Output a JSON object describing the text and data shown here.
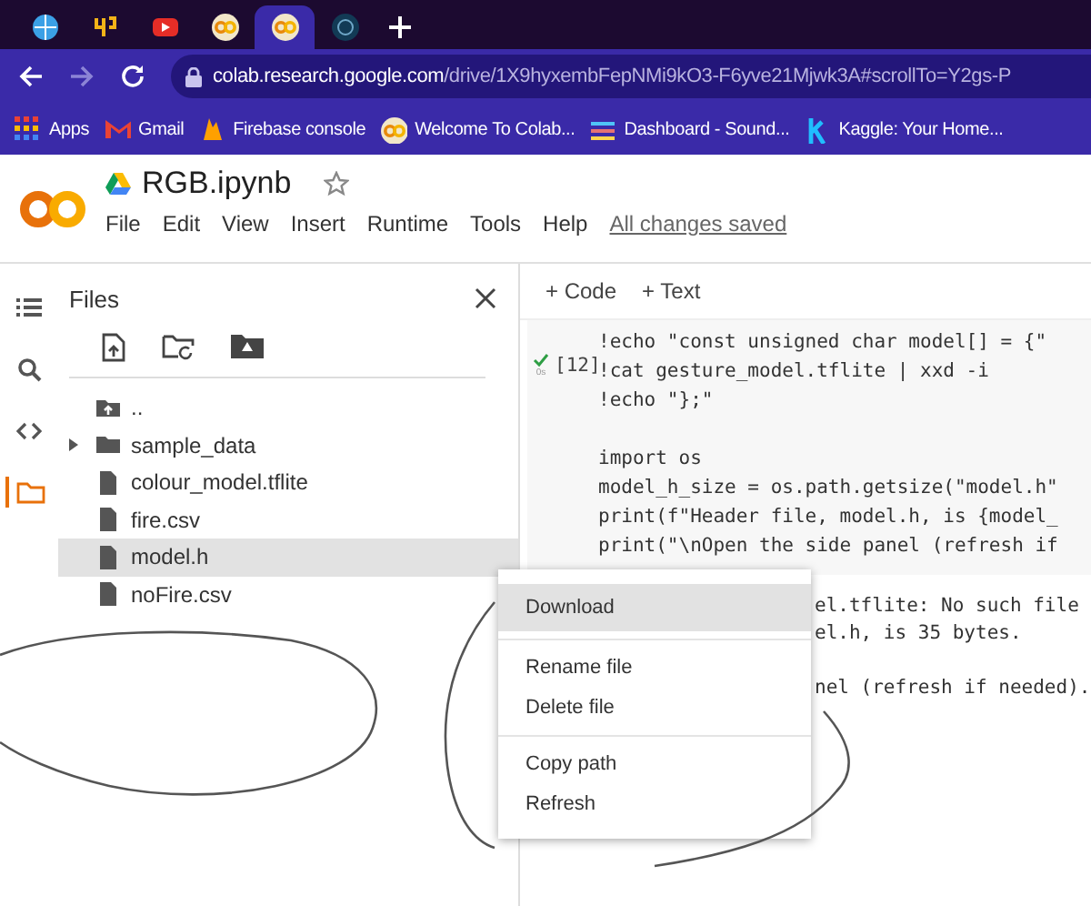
{
  "browser": {
    "tabs": [
      {
        "kind": "globe",
        "selected": false
      },
      {
        "kind": "letters",
        "selected": false
      },
      {
        "kind": "video",
        "selected": false
      },
      {
        "kind": "colab",
        "selected": false
      },
      {
        "kind": "colab",
        "selected": true
      },
      {
        "kind": "badge",
        "selected": false
      }
    ],
    "address_bar": {
      "host": "colab.research.google.com",
      "path": "/drive/1X9hyxembFepNMi9kO3-F6yve21Mjwk3A#scrollTo=Y2gs-P"
    },
    "bookmarks": [
      {
        "kind": "apps",
        "label": "Apps"
      },
      {
        "kind": "mail",
        "label": "Gmail"
      },
      {
        "kind": "flame",
        "label": "Firebase console"
      },
      {
        "kind": "colab",
        "label": "Welcome To Colab..."
      },
      {
        "kind": "bars",
        "label": "Dashboard - Sound..."
      },
      {
        "kind": "k",
        "label": "Kaggle: Your Home..."
      }
    ]
  },
  "notebook": {
    "title": "RGB.ipynb",
    "starred": false,
    "menu": [
      "File",
      "Edit",
      "View",
      "Insert",
      "Runtime",
      "Tools",
      "Help"
    ],
    "save_status": "All changes saved"
  },
  "sidebar": {
    "icons": [
      {
        "kind": "menu",
        "selected": false
      },
      {
        "kind": "search",
        "selected": false
      },
      {
        "kind": "code",
        "selected": false
      },
      {
        "kind": "folder",
        "selected": true
      }
    ]
  },
  "files_panel": {
    "title": "Files",
    "items": [
      {
        "kind": "parent",
        "name": "..",
        "selected": false
      },
      {
        "kind": "folder",
        "name": "sample_data",
        "selected": false
      },
      {
        "kind": "file",
        "name": "colour_model.tflite",
        "selected": false
      },
      {
        "kind": "file",
        "name": "fire.csv",
        "selected": false
      },
      {
        "kind": "file",
        "name": "model.h",
        "selected": true
      },
      {
        "kind": "file",
        "name": "noFire.csv",
        "selected": false
      }
    ]
  },
  "toolbar": [
    "+ Code",
    "+ Text"
  ],
  "cell": {
    "execution_count": "[12]",
    "duration": "0s",
    "code": [
      [
        "!echo \"const unsigned char model[] = {\"",
        "!cat gesture_model.tflite | xxd -i",
        "!echo \"};\""
      ],
      [
        "import os",
        "model_h_size = os.path.getsize(\"model.h\"",
        "print(f\"Header file, model.h, is {model_",
        "print(\"\\nOpen the side panel (refresh if"
      ]
    ],
    "output": [
      [
        "el.tflite: No such file",
        "el.h, is 35 bytes."
      ],
      [
        "nel (refresh if needed)."
      ]
    ]
  },
  "context_menu": {
    "groups": [
      [
        {
          "label": "Download",
          "selected": true
        }
      ],
      [
        {
          "label": "Rename file",
          "selected": false
        },
        {
          "label": "Delete file",
          "selected": false
        }
      ],
      [
        {
          "label": "Copy path",
          "selected": false
        },
        {
          "label": "Refresh",
          "selected": false
        }
      ]
    ]
  }
}
